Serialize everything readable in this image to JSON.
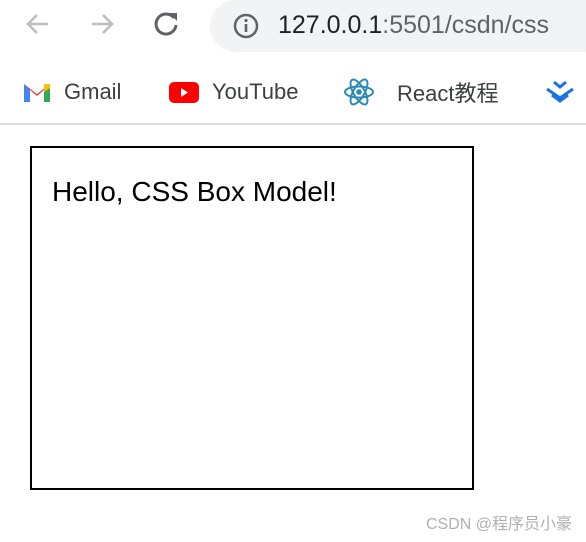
{
  "browser": {
    "url_host": "127.0.0.1",
    "url_rest": ":5501/csdn/css"
  },
  "bookmarks": [
    {
      "label": "Gmail",
      "icon": "gmail-icon"
    },
    {
      "label": "YouTube",
      "icon": "youtube-icon"
    },
    {
      "label": "React教程",
      "icon": "react-icon"
    }
  ],
  "page": {
    "text": "Hello, CSS Box Model!"
  },
  "watermark": "CSDN @程序员小豪"
}
